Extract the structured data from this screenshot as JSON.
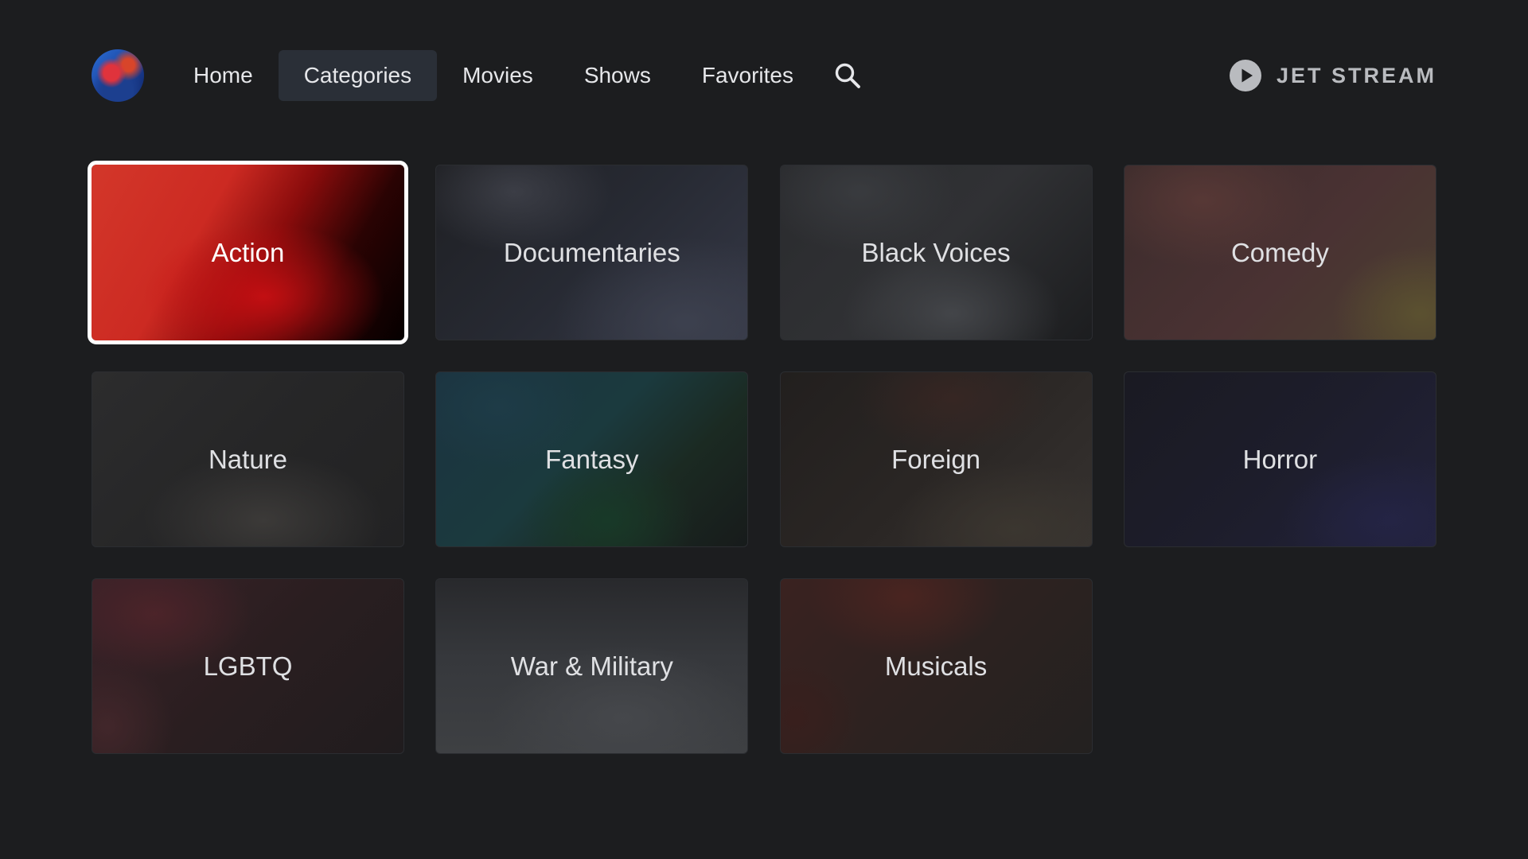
{
  "nav": {
    "items": [
      {
        "label": "Home",
        "active": false
      },
      {
        "label": "Categories",
        "active": true
      },
      {
        "label": "Movies",
        "active": false
      },
      {
        "label": "Shows",
        "active": false
      },
      {
        "label": "Favorites",
        "active": false
      }
    ],
    "search_icon": "search-icon",
    "avatar_icon": "user-avatar"
  },
  "brand": {
    "name": "JET STREAM",
    "icon": "play-circle-icon"
  },
  "categories": [
    {
      "label": "Action",
      "selected": true
    },
    {
      "label": "Documentaries",
      "selected": false
    },
    {
      "label": "Black Voices",
      "selected": false
    },
    {
      "label": "Comedy",
      "selected": false
    },
    {
      "label": "Nature",
      "selected": false
    },
    {
      "label": "Fantasy",
      "selected": false
    },
    {
      "label": "Foreign",
      "selected": false
    },
    {
      "label": "Horror",
      "selected": false
    },
    {
      "label": "LGBTQ",
      "selected": false
    },
    {
      "label": "War & Military",
      "selected": false
    },
    {
      "label": "Musicals",
      "selected": false
    }
  ],
  "colors": {
    "background": "#1c1d1f",
    "active_nav_bg": "#2a2f37",
    "text": "#e6e7ea",
    "brand_text": "#b9bbbf",
    "selection_outline": "#ffffff",
    "action_red": "#cc2a22"
  }
}
